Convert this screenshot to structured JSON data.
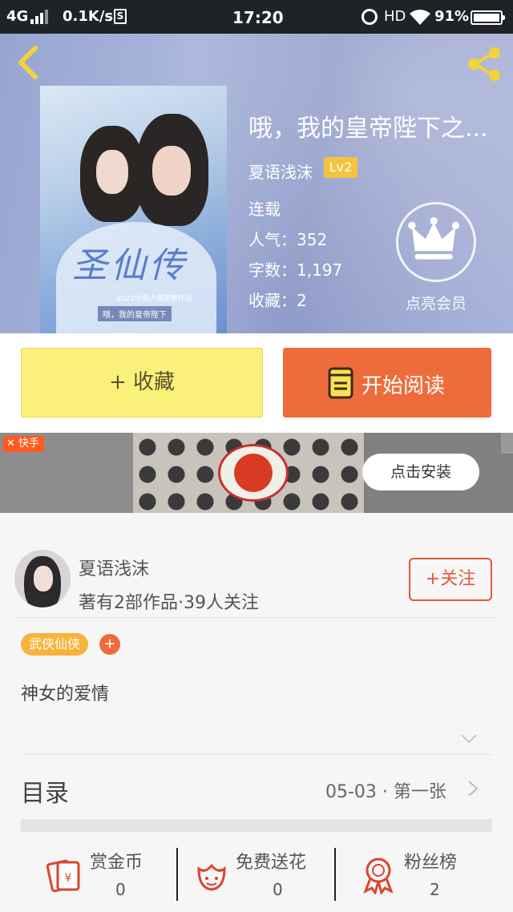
{
  "status_bar": {
    "network": "4G",
    "speed": "0.1K/s",
    "s_icon": "S",
    "time": "17:20",
    "hd": "HD",
    "battery": "91%"
  },
  "nav": {
    "back_icon": "chevron-left-icon",
    "share_icon": "share-icon"
  },
  "book": {
    "title": "哦，我的皇帝陛下之...",
    "author": "夏语浅沫",
    "level": "Lv2",
    "status": "连载",
    "popularity": "人气：352",
    "word_count": "字数：1,197",
    "favorites": "收藏：2",
    "vip_label": "点亮会员",
    "cover_art_text": "圣仙传",
    "cover_caption_top": "2022小说大赛参赛作品",
    "cover_caption_bottom": "哦，我的皇帝陛下"
  },
  "actions": {
    "collect": "+ 收藏",
    "read": "开始阅读"
  },
  "ad": {
    "brand": "快手",
    "install": "点击安装"
  },
  "author_section": {
    "name": "夏语浅沫",
    "works": "著有2部作品·39人关注",
    "follow": "+关注"
  },
  "tags": {
    "genre": "武侠仙侠",
    "add": "+"
  },
  "synopsis": "神女的爱情",
  "catalog": {
    "title": "目录",
    "latest": "05-03 · 第一张"
  },
  "stats": [
    {
      "label": "赏金币",
      "value": "0",
      "icon": "red-envelope-icon"
    },
    {
      "label": "免费送花",
      "value": "0",
      "icon": "flower-icon"
    },
    {
      "label": "粉丝榜",
      "value": "2",
      "icon": "medal-icon"
    }
  ],
  "colors": {
    "accent": "#ee6c3c",
    "collect_yellow": "#fbf17a",
    "tag_orange": "#f7b33a",
    "icon_red": "#d9462f",
    "nav_yellow": "#f4d23b"
  }
}
